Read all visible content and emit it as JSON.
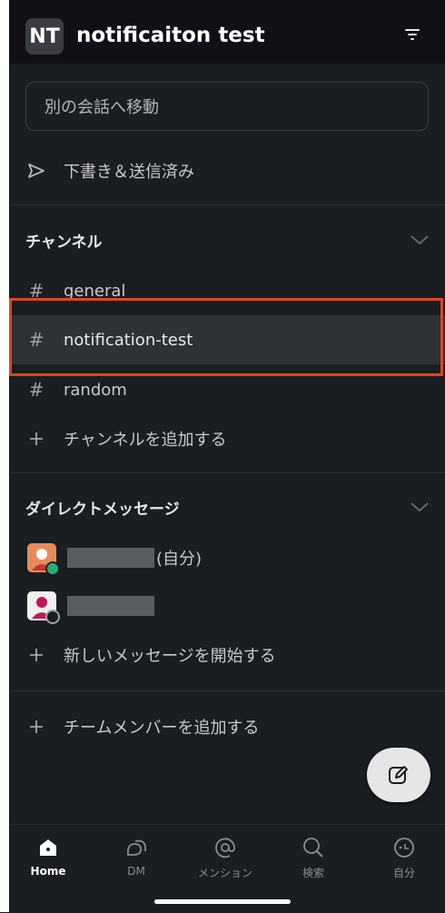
{
  "workspace": {
    "initials": "NT",
    "name": "notificaiton test"
  },
  "jump": {
    "placeholder": "別の会話へ移動"
  },
  "drafts": {
    "label": "下書き＆送信済み"
  },
  "channels_section": {
    "title": "チャンネル",
    "items": [
      {
        "name": "general"
      },
      {
        "name": "notification-test",
        "selected": true
      },
      {
        "name": "random"
      }
    ],
    "add_label": "チャンネルを追加する"
  },
  "dm_section": {
    "title": "ダイレクトメッセージ",
    "items": [
      {
        "suffix": "(自分)",
        "status": "online"
      },
      {
        "suffix": "",
        "status": "offline"
      }
    ],
    "new_label": "新しいメッセージを開始する"
  },
  "add_members": {
    "label": "チームメンバーを追加する"
  },
  "tabs": [
    {
      "label": "Home",
      "icon": "home-icon",
      "active": true
    },
    {
      "label": "DM",
      "icon": "dm-icon"
    },
    {
      "label": "メンション",
      "icon": "mention-icon"
    },
    {
      "label": "検索",
      "icon": "search-icon"
    },
    {
      "label": "自分",
      "icon": "you-icon"
    }
  ],
  "colors": {
    "background": "#1a1d21",
    "highlight": "#e0451f",
    "online": "#2bac76"
  }
}
